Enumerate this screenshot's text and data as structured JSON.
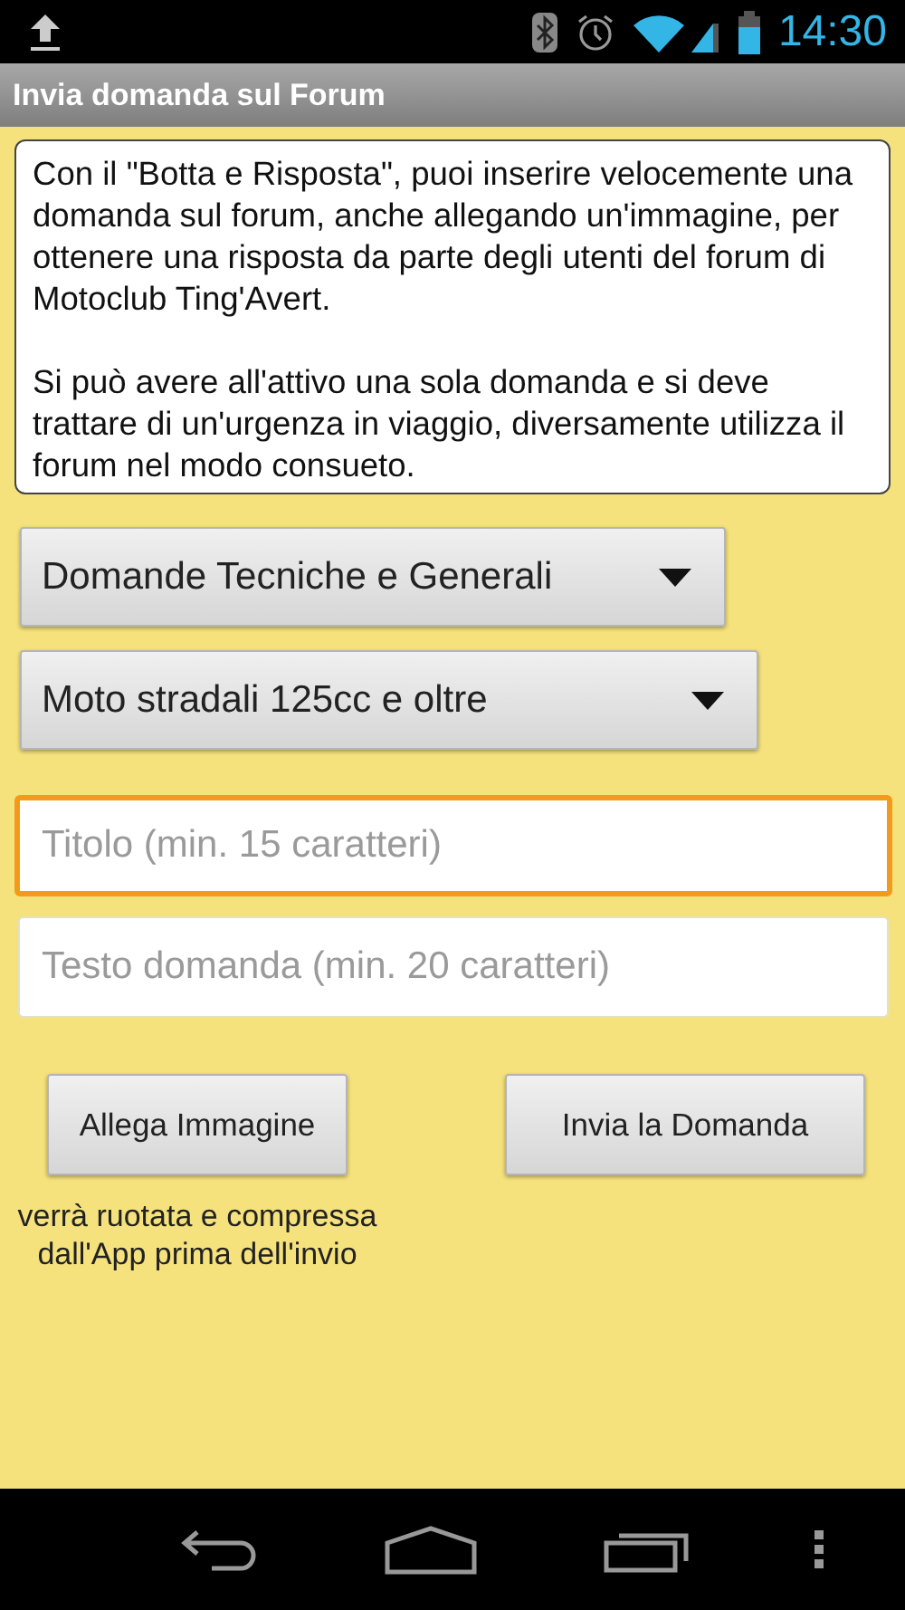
{
  "status_bar": {
    "time": "14:30"
  },
  "action_bar": {
    "title": "Invia domanda sul Forum"
  },
  "info": {
    "paragraphs": [
      "Con il \"Botta e Risposta\", puoi inserire velocemente una domanda sul forum, anche allegando un'immagine, per ottenere una risposta da parte degli utenti del forum di Motoclub Ting'Avert.",
      "Si può avere all'attivo una sola domanda e si deve trattare di un'urgenza in viaggio, diversamente utilizza il forum nel modo consueto."
    ]
  },
  "spinners": [
    {
      "value": "Domande Tecniche e Generali"
    },
    {
      "value": "Moto stradali 125cc e oltre"
    }
  ],
  "fields": [
    {
      "placeholder": "Titolo (min. 15 caratteri)",
      "focused": true
    },
    {
      "placeholder": "Testo domanda (min. 20 caratteri)",
      "focused": false
    }
  ],
  "buttons": [
    {
      "label": "Allega Immagine",
      "note": "verrà ruotata e compressa dall'App prima dell'invio"
    },
    {
      "label": "Invia la Domanda"
    }
  ]
}
